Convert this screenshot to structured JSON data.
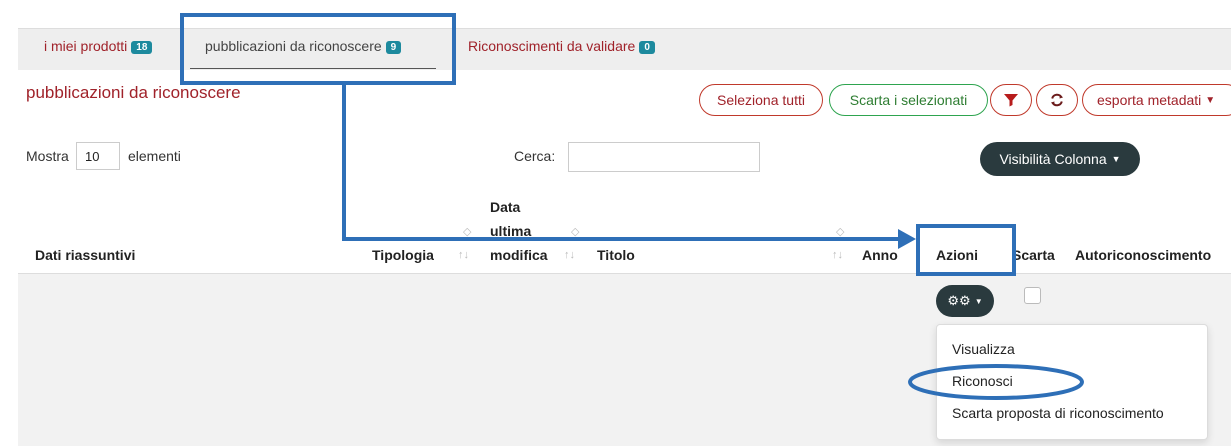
{
  "tabs": [
    {
      "label": "i miei prodotti",
      "count": "18"
    },
    {
      "label": "pubblicazioni da riconoscere",
      "count": "9"
    },
    {
      "label": "Riconoscimenti da validare",
      "count": "0"
    }
  ],
  "panel": {
    "title": "pubblicazioni da riconoscere"
  },
  "toolbar": {
    "select_all": "Seleziona tutti",
    "discard_selected": "Scarta i selezionati",
    "export_metadata": "esporta metadati"
  },
  "length_menu": {
    "prefix": "Mostra",
    "value": "10",
    "suffix": "elementi"
  },
  "search": {
    "label": "Cerca:",
    "value": ""
  },
  "column_visibility": "Visibilità Colonna",
  "table": {
    "headers": {
      "summary": "Dati riassuntivi",
      "type": "Tipologia",
      "last_modified_1": "Data",
      "last_modified_2": "ultima",
      "last_modified_3": "modifica",
      "title": "Titolo",
      "year": "Anno",
      "actions": "Azioni",
      "discard": "Scarta",
      "self_recognition": "Autoriconoscimento"
    }
  },
  "actions_menu": {
    "items": [
      "Visualizza",
      "Riconosci",
      "Scarta proposta di riconoscimento"
    ]
  },
  "colors": {
    "accent_red": "#a0222a",
    "badge_teal": "#1d8a9e",
    "dark_button": "#2a3a3e",
    "annotation_blue": "#2e6fb7"
  }
}
